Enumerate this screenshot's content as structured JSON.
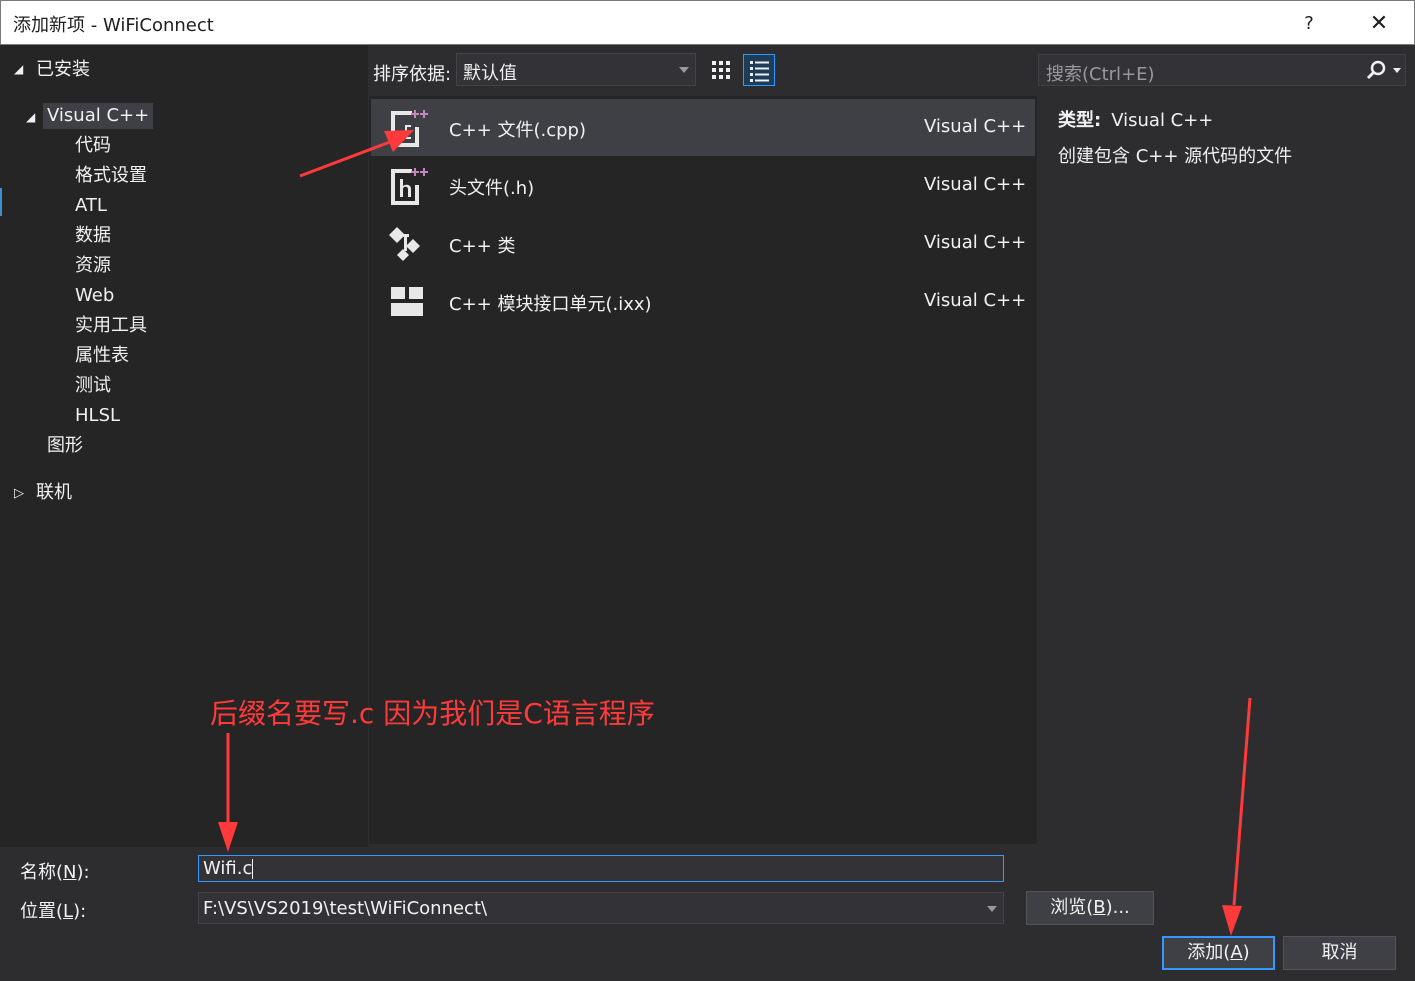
{
  "window": {
    "title": "添加新项 - WiFiConnect",
    "help_label": "?",
    "close_label": "✕"
  },
  "sidebar": {
    "installed": "已安装",
    "visual_cpp": "Visual C++",
    "children": [
      "代码",
      "格式设置",
      "ATL",
      "数据",
      "资源",
      "Web",
      "实用工具",
      "属性表",
      "测试",
      "HLSL"
    ],
    "graphics": "图形",
    "online": "联机"
  },
  "sort": {
    "label": "排序依据:",
    "value": "默认值"
  },
  "items": [
    {
      "name": "C++ 文件(.cpp)",
      "category": "Visual C++",
      "icon": "cpp-file-icon",
      "selected": true
    },
    {
      "name": "头文件(.h)",
      "category": "Visual C++",
      "icon": "header-file-icon",
      "selected": false
    },
    {
      "name": "C++ 类",
      "category": "Visual C++",
      "icon": "cpp-class-icon",
      "selected": false
    },
    {
      "name": "C++ 模块接口单元(.ixx)",
      "category": "Visual C++",
      "icon": "module-interface-icon",
      "selected": false
    }
  ],
  "search": {
    "placeholder": "搜索(Ctrl+E)"
  },
  "details": {
    "type_label": "类型:",
    "type_value": "Visual C++",
    "description": "创建包含 C++ 源代码的文件"
  },
  "annotation": {
    "text": "后缀名要写.c 因为我们是C语言程序",
    "color": "#ff3a3a"
  },
  "form": {
    "name_label_prefix": "名称(",
    "name_label_key": "N",
    "name_label_suffix": "):",
    "name_value": "Wifi.c",
    "location_label_prefix": "位置(",
    "location_label_key": "L",
    "location_label_suffix": "):",
    "location_value": "F:\\VS\\VS2019\\test\\WiFiConnect\\"
  },
  "buttons": {
    "browse_prefix": "浏览(",
    "browse_key": "B",
    "browse_suffix": ")...",
    "add_prefix": "添加(",
    "add_key": "A",
    "add_suffix": ")",
    "cancel": "取消"
  },
  "colors": {
    "accent": "#3399ff",
    "background": "#2d2d30",
    "panel": "#252526",
    "selection": "#3f3f46",
    "cpp_plus": "#c586c0"
  }
}
